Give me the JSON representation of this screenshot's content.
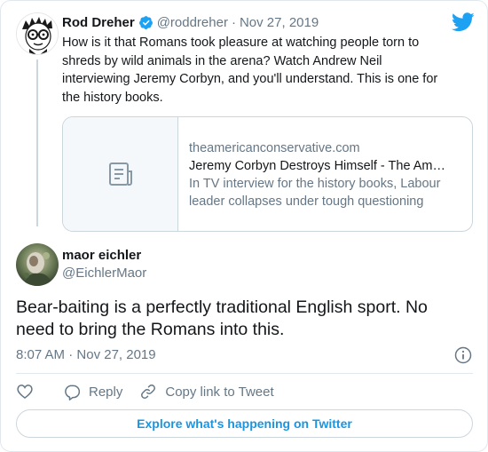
{
  "parent_tweet": {
    "author_name": "Rod Dreher",
    "handle": "@roddreher",
    "separator": "·",
    "date": "Nov 27, 2019",
    "text": "How is it that Romans took pleasure at watching people torn to shreds by wild animals in the arena? Watch Andrew Neil interviewing Jeremy Corbyn, and you'll understand. This is one for the history books.",
    "link_card": {
      "domain": "theamericanconservative.com",
      "title": "Jeremy Corbyn Destroys Himself - The Am…",
      "description": "In TV interview for the history books, Labour leader collapses under tough questioning",
      "thumb_icon": "document-icon"
    }
  },
  "main_tweet": {
    "author_name": "maor eichler",
    "handle": "@EichlerMaor",
    "text": "Bear-baiting is a perfectly traditional English sport. No need to bring the Romans into this.",
    "time": "8:07 AM",
    "separator": "·",
    "date": "Nov 27, 2019"
  },
  "actions": {
    "reply_label": "Reply",
    "copy_link_label": "Copy link to Tweet"
  },
  "footer": {
    "explore_label": "Explore what's happening on Twitter"
  },
  "colors": {
    "twitter_blue": "#1da1f2",
    "link_blue": "#1b95e0",
    "secondary_text": "#657786",
    "border": "#e1e8ed"
  }
}
